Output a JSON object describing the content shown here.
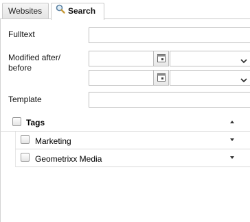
{
  "tabs": [
    {
      "label": "Websites"
    },
    {
      "label": "Search"
    }
  ],
  "form": {
    "fulltext_label": "Fulltext",
    "fulltext_value": "",
    "modified_label_line1": "Modified after/",
    "modified_label_line2": "before",
    "modified_after_date": "",
    "modified_after_time": "",
    "modified_before_date": "",
    "modified_before_time": "",
    "template_label": "Template",
    "template_value": ""
  },
  "tags": {
    "title": "Tags",
    "items": [
      {
        "label": "Marketing"
      },
      {
        "label": "Geometrixx Media"
      }
    ]
  },
  "colors": {
    "border": "#bdbdbd",
    "tab_border": "#c9c9c9"
  }
}
